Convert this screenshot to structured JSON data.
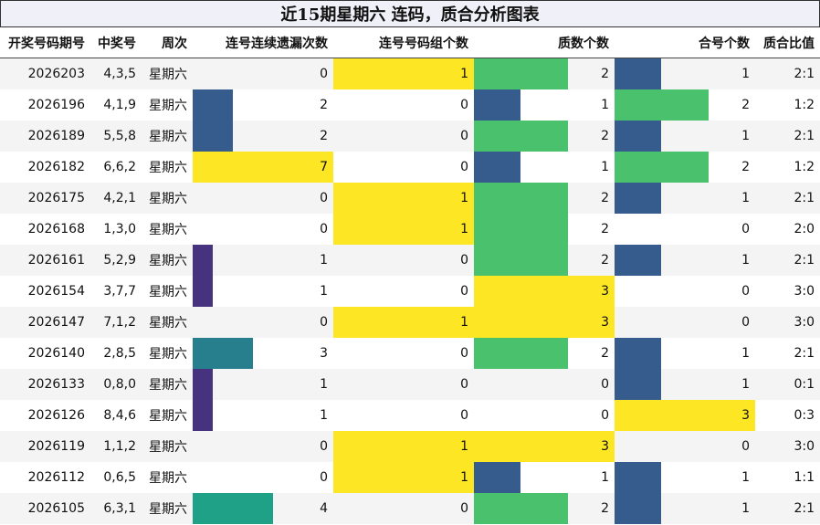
{
  "title": "近15期星期六 连码，质合分析图表",
  "headers": [
    "开奖号码期号",
    "中奖号",
    "周次",
    "连号连续遗漏次数",
    "连号号码组个数",
    "质数个数",
    "合号个数",
    "质合比值"
  ],
  "palette": {
    "0": "#440154",
    "1": "#46327e",
    "2": "#365c8d",
    "3": "#277f8e",
    "4": "#1fa187",
    "5": "#4ac16d",
    "6": "#a0da39",
    "7": "#fde725",
    "empty": "transparent"
  },
  "rows": [
    {
      "issue": "2026203",
      "nums": "4,3,5",
      "week": "星期六",
      "miss": 0,
      "groups": 1,
      "prime": 2,
      "comp": 1,
      "ratio": "2:1"
    },
    {
      "issue": "2026196",
      "nums": "4,1,9",
      "week": "星期六",
      "miss": 2,
      "groups": 0,
      "prime": 1,
      "comp": 2,
      "ratio": "1:2"
    },
    {
      "issue": "2026189",
      "nums": "5,5,8",
      "week": "星期六",
      "miss": 2,
      "groups": 0,
      "prime": 2,
      "comp": 1,
      "ratio": "2:1"
    },
    {
      "issue": "2026182",
      "nums": "6,6,2",
      "week": "星期六",
      "miss": 7,
      "groups": 0,
      "prime": 1,
      "comp": 2,
      "ratio": "1:2"
    },
    {
      "issue": "2026175",
      "nums": "4,2,1",
      "week": "星期六",
      "miss": 0,
      "groups": 1,
      "prime": 2,
      "comp": 1,
      "ratio": "2:1"
    },
    {
      "issue": "2026168",
      "nums": "1,3,0",
      "week": "星期六",
      "miss": 0,
      "groups": 1,
      "prime": 2,
      "comp": 0,
      "ratio": "2:0"
    },
    {
      "issue": "2026161",
      "nums": "5,2,9",
      "week": "星期六",
      "miss": 1,
      "groups": 0,
      "prime": 2,
      "comp": 1,
      "ratio": "2:1"
    },
    {
      "issue": "2026154",
      "nums": "3,7,7",
      "week": "星期六",
      "miss": 1,
      "groups": 0,
      "prime": 3,
      "comp": 0,
      "ratio": "3:0"
    },
    {
      "issue": "2026147",
      "nums": "7,1,2",
      "week": "星期六",
      "miss": 0,
      "groups": 1,
      "prime": 3,
      "comp": 0,
      "ratio": "3:0"
    },
    {
      "issue": "2026140",
      "nums": "2,8,5",
      "week": "星期六",
      "miss": 3,
      "groups": 0,
      "prime": 2,
      "comp": 1,
      "ratio": "2:1"
    },
    {
      "issue": "2026133",
      "nums": "0,8,0",
      "week": "星期六",
      "miss": 1,
      "groups": 0,
      "prime": 0,
      "comp": 1,
      "ratio": "0:1"
    },
    {
      "issue": "2026126",
      "nums": "8,4,6",
      "week": "星期六",
      "miss": 1,
      "groups": 0,
      "prime": 0,
      "comp": 3,
      "ratio": "0:3"
    },
    {
      "issue": "2026119",
      "nums": "1,1,2",
      "week": "星期六",
      "miss": 0,
      "groups": 1,
      "prime": 3,
      "comp": 0,
      "ratio": "3:0"
    },
    {
      "issue": "2026112",
      "nums": "0,6,5",
      "week": "星期六",
      "miss": 0,
      "groups": 1,
      "prime": 1,
      "comp": 1,
      "ratio": "1:1"
    },
    {
      "issue": "2026105",
      "nums": "6,3,1",
      "week": "星期六",
      "miss": 4,
      "groups": 0,
      "prime": 2,
      "comp": 1,
      "ratio": "2:1"
    }
  ]
}
